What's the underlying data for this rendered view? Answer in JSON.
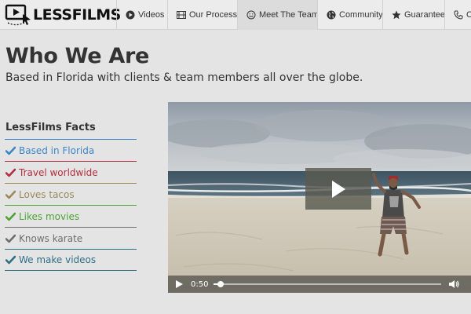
{
  "brand": {
    "name": "LESSFILMS"
  },
  "nav": {
    "items": [
      {
        "label": "Videos",
        "icon": "play-circle-icon"
      },
      {
        "label": "Our Process",
        "icon": "film-icon"
      },
      {
        "label": "Meet The Team",
        "icon": "smiley-icon",
        "active": true
      },
      {
        "label": "Community",
        "icon": "globe-icon"
      },
      {
        "label": "Guarantee",
        "icon": "star-icon"
      },
      {
        "label": "Co",
        "icon": "phone-icon"
      }
    ]
  },
  "page": {
    "title": "Who We Are",
    "subtitle": "Based in Florida with clients & team members all over the globe."
  },
  "facts": {
    "heading": "LessFilms Facts",
    "items": [
      {
        "label": "Based in Florida",
        "color": "#3d85c6"
      },
      {
        "label": "Travel worldwide",
        "color": "#b32e3f"
      },
      {
        "label": "Loves tacos",
        "color": "#9a8a5a"
      },
      {
        "label": "Likes movies",
        "color": "#4ea334"
      },
      {
        "label": "Knows karate",
        "color": "#6e6e6e"
      },
      {
        "label": "We make videos",
        "color": "#2e6f86"
      }
    ]
  },
  "video": {
    "time": "0:50",
    "progress": 0.03
  }
}
